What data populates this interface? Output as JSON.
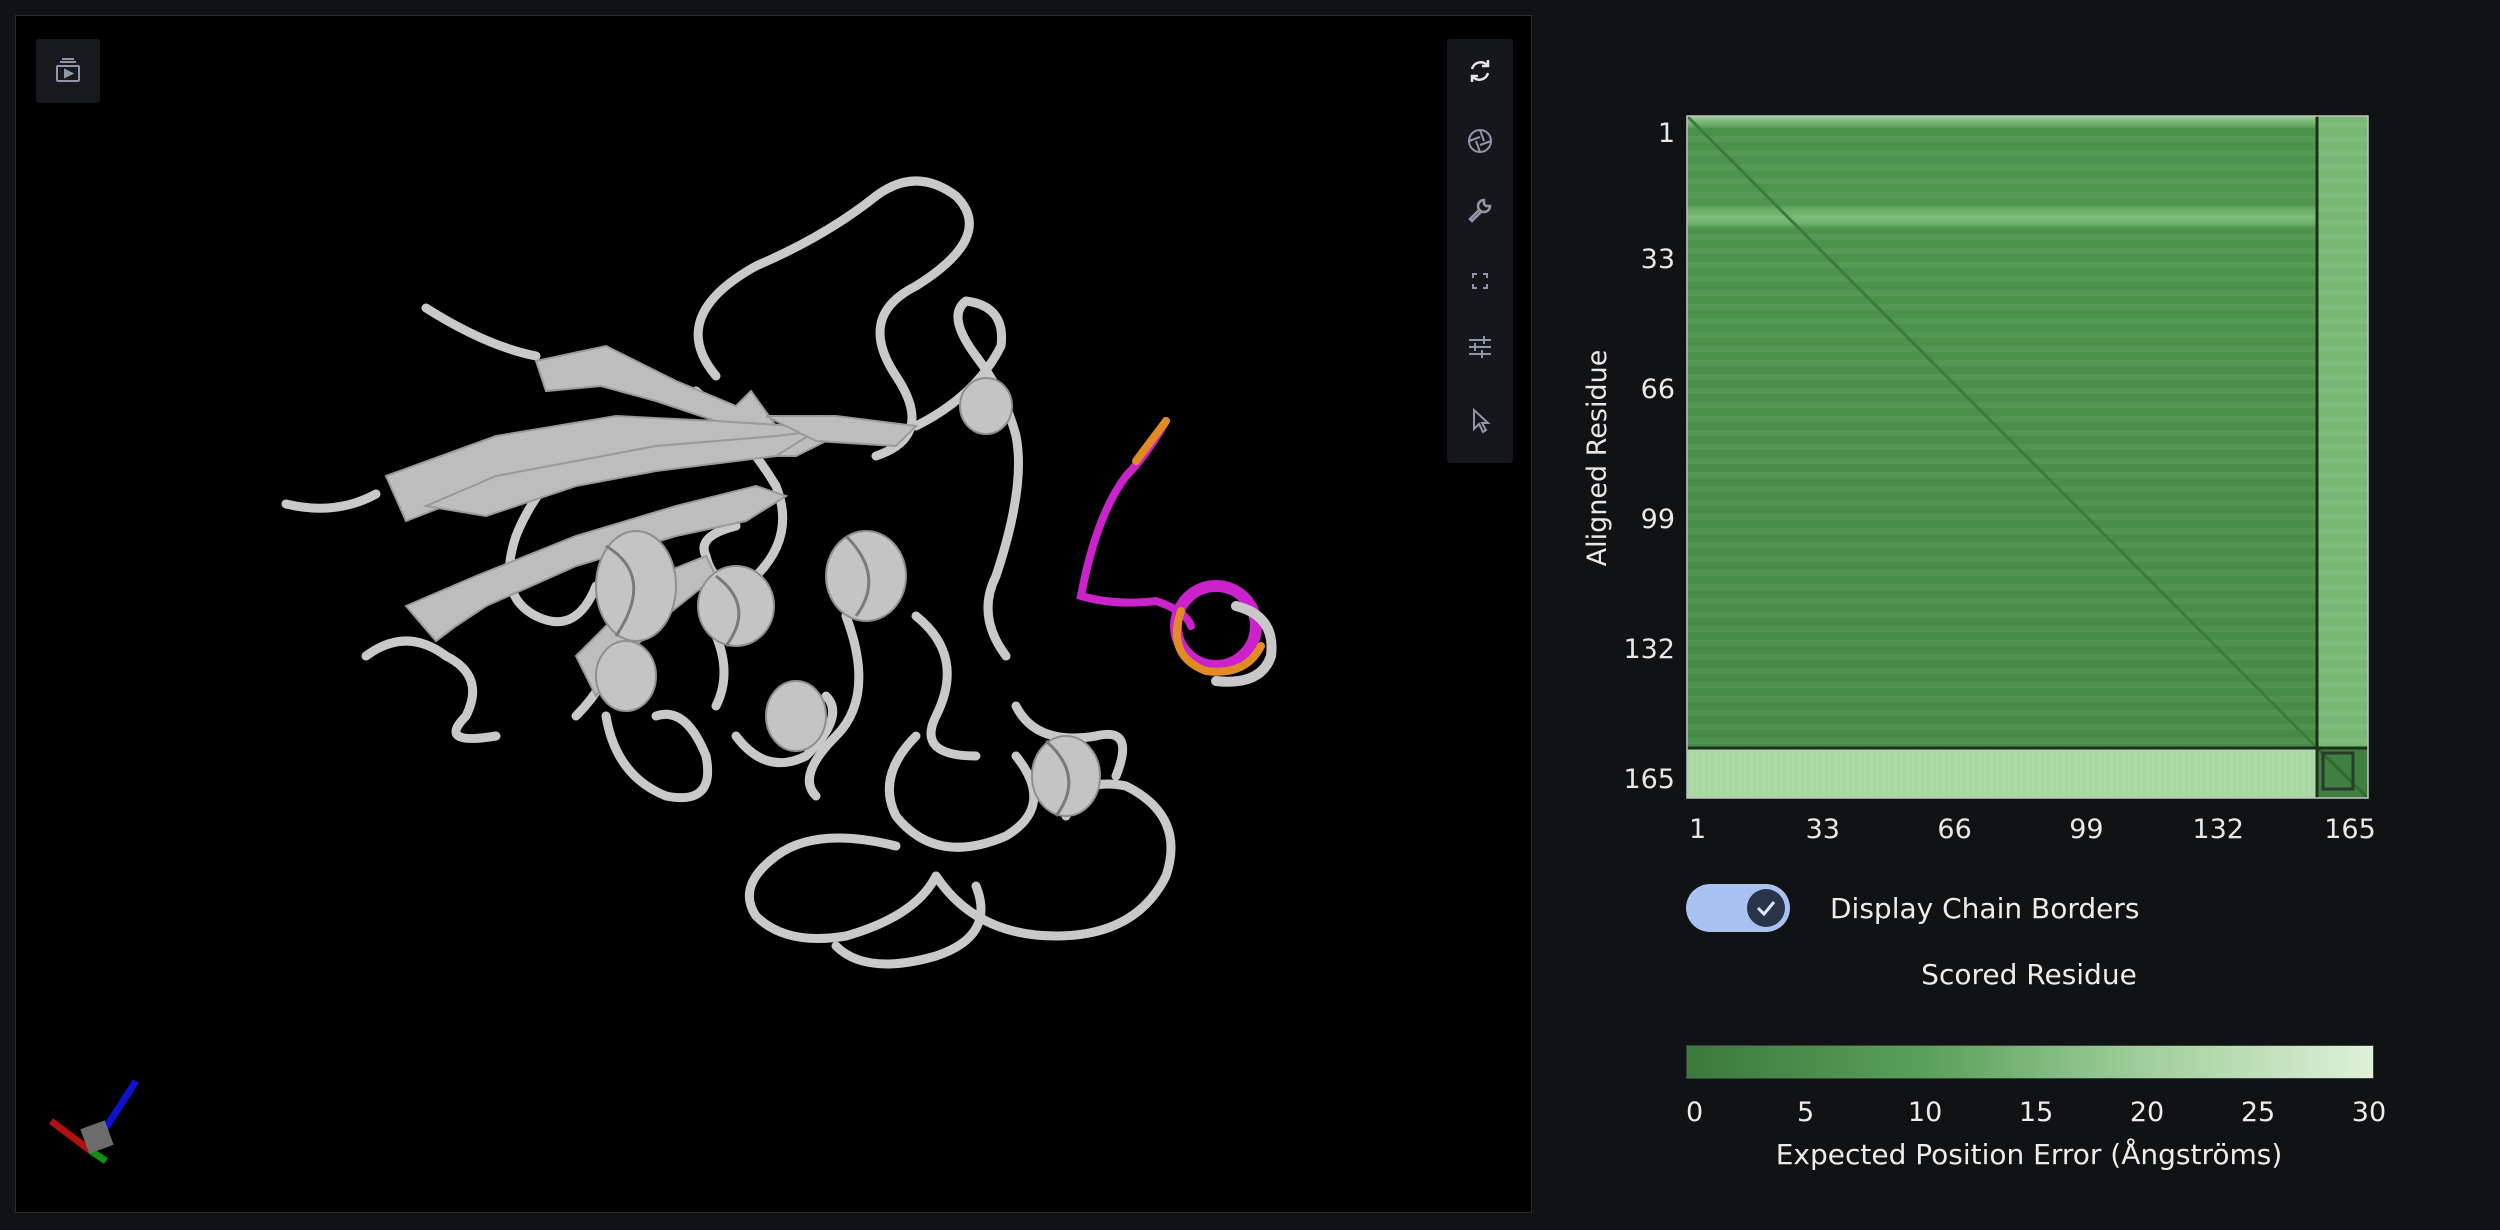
{
  "viewer": {
    "icons": [
      "playlist-play-icon",
      "refresh-icon",
      "camera-aperture-icon",
      "wrench-icon",
      "fullscreen-icon",
      "sliders-icon",
      "pointer-icon"
    ]
  },
  "pae": {
    "y_label": "Aligned Residue",
    "x_label": "Scored Residue",
    "x_ticks": [
      "1",
      "33",
      "66",
      "99",
      "132",
      "165"
    ],
    "y_ticks": [
      "1",
      "33",
      "66",
      "99",
      "132",
      "165"
    ]
  },
  "chain_borders": {
    "label": "Display Chain Borders",
    "enabled": true
  },
  "colorbar": {
    "ticks": [
      "0",
      "5",
      "10",
      "15",
      "20",
      "25",
      "30"
    ],
    "title": "Expected Position Error (Ångströms)",
    "colors": [
      "#3a7a3c",
      "#5aa05a",
      "#9ccd98",
      "#dff1d9"
    ]
  },
  "chart_data": {
    "type": "heatmap",
    "xlabel": "Scored Residue",
    "ylabel": "Aligned Residue",
    "x_ticks": [
      1,
      33,
      66,
      99,
      132,
      165
    ],
    "y_ticks": [
      1,
      33,
      66,
      99,
      132,
      165
    ],
    "colorbar_range": [
      0,
      31
    ],
    "colorbar_label": "Expected Position Error (Ångströms)",
    "chain_boundary": 157
  }
}
